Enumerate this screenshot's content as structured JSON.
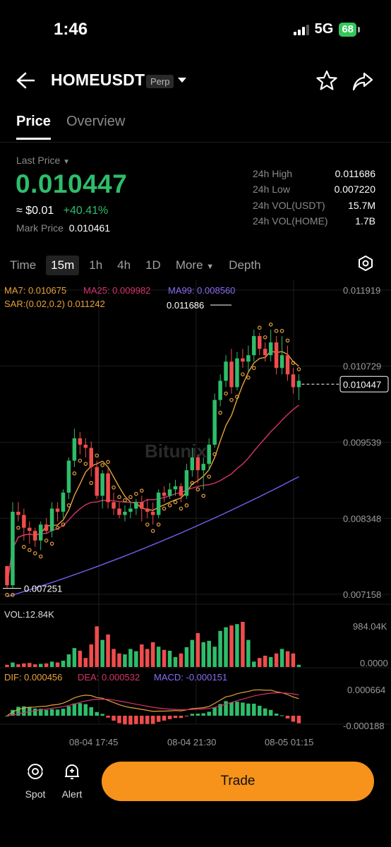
{
  "status": {
    "time": "1:46",
    "network": "5G",
    "battery": "68"
  },
  "header": {
    "symbol": "HOMEUSDT",
    "badge": "Perp"
  },
  "tabs": [
    "Price",
    "Overview"
  ],
  "ticker": {
    "last_label": "Last Price",
    "last_price": "0.010447",
    "approx": "≈ $0.01",
    "change": "+40.41%",
    "mark_label": "Mark Price",
    "mark_value": "0.010461",
    "stats": [
      {
        "label": "24h High",
        "value": "0.011686"
      },
      {
        "label": "24h Low",
        "value": "0.007220"
      },
      {
        "label": "24h VOL(USDT)",
        "value": "15.7M"
      },
      {
        "label": "24h VOL(HOME)",
        "value": "1.7B"
      }
    ]
  },
  "timeframes": {
    "time": "Time",
    "items": [
      "15m",
      "1h",
      "4h",
      "1D"
    ],
    "active": "15m",
    "more": "More",
    "depth": "Depth"
  },
  "indicators": {
    "ma7": "MA7: 0.010675",
    "ma25": "MA25: 0.009982",
    "ma99": "MA99: 0.008560",
    "sar": "SAR:(0.02,0.2)  0.011242",
    "vol": "VOL:12.84K",
    "dif": "DIF: 0.000456",
    "dea": "DEA: 0.000532",
    "macd": "MACD: -0.000151"
  },
  "chart_data": {
    "type": "candlestick",
    "price_axis": [
      "0.011919",
      "0.010729",
      "0.009539",
      "0.008348",
      "0.007158"
    ],
    "price_range": [
      0.007158,
      0.011919
    ],
    "high_label": "0.011686",
    "low_label": "0.007251",
    "current_label": "0.010447",
    "vol_axis": [
      "984.04K",
      "0.0000"
    ],
    "macd_axis": [
      "0.000664",
      "-0.000188"
    ],
    "time_labels": [
      "08-04 17:45",
      "08-04 21:30",
      "08-05 01:15"
    ],
    "watermark": "Bitunix",
    "colors": {
      "up": "#2ebd6b",
      "down": "#f04c4c",
      "ma7": "#e8a23a",
      "ma25": "#d6336c",
      "ma99": "#7c5cf0"
    },
    "candles": [
      [
        0.0076,
        0.0076,
        0.00725,
        0.0073
      ],
      [
        0.0073,
        0.0086,
        0.00725,
        0.00845
      ],
      [
        0.00845,
        0.0086,
        0.0083,
        0.0084
      ],
      [
        0.0084,
        0.0085,
        0.008,
        0.0082
      ],
      [
        0.0082,
        0.0083,
        0.00795,
        0.00815
      ],
      [
        0.00815,
        0.0082,
        0.0079,
        0.008
      ],
      [
        0.008,
        0.0083,
        0.00785,
        0.00825
      ],
      [
        0.00825,
        0.00835,
        0.0081,
        0.00815
      ],
      [
        0.00815,
        0.0086,
        0.00805,
        0.0085
      ],
      [
        0.0085,
        0.0086,
        0.0083,
        0.00845
      ],
      [
        0.00845,
        0.0088,
        0.00835,
        0.00875
      ],
      [
        0.00875,
        0.0093,
        0.00865,
        0.00925
      ],
      [
        0.00925,
        0.00975,
        0.00915,
        0.0096
      ],
      [
        0.0096,
        0.0097,
        0.00935,
        0.0095
      ],
      [
        0.0095,
        0.0096,
        0.0093,
        0.00945
      ],
      [
        0.00945,
        0.00955,
        0.009,
        0.00915
      ],
      [
        0.00915,
        0.00925,
        0.00865,
        0.0087
      ],
      [
        0.0087,
        0.0091,
        0.0085,
        0.00905
      ],
      [
        0.00905,
        0.00915,
        0.0085,
        0.0086
      ],
      [
        0.0086,
        0.00875,
        0.0084,
        0.0085
      ],
      [
        0.0085,
        0.0086,
        0.00835,
        0.0084
      ],
      [
        0.0084,
        0.00855,
        0.0083,
        0.00845
      ],
      [
        0.00845,
        0.0086,
        0.00835,
        0.0085
      ],
      [
        0.0085,
        0.00865,
        0.0084,
        0.0086
      ],
      [
        0.0086,
        0.0087,
        0.0083,
        0.0085
      ],
      [
        0.0085,
        0.00865,
        0.00835,
        0.00845
      ],
      [
        0.00845,
        0.0086,
        0.00825,
        0.0084
      ],
      [
        0.0084,
        0.0088,
        0.00835,
        0.00875
      ],
      [
        0.00875,
        0.00885,
        0.0086,
        0.0087
      ],
      [
        0.0087,
        0.0089,
        0.00865,
        0.0088
      ],
      [
        0.0088,
        0.00895,
        0.0087,
        0.00885
      ],
      [
        0.00885,
        0.0089,
        0.0086,
        0.0087
      ],
      [
        0.0087,
        0.0092,
        0.00865,
        0.0091
      ],
      [
        0.0091,
        0.00945,
        0.009,
        0.0093
      ],
      [
        0.0093,
        0.00935,
        0.0089,
        0.0091
      ],
      [
        0.0091,
        0.0093,
        0.0088,
        0.0092
      ],
      [
        0.0092,
        0.0096,
        0.0091,
        0.0095
      ],
      [
        0.0095,
        0.0103,
        0.00945,
        0.0102
      ],
      [
        0.0102,
        0.0106,
        0.0101,
        0.0105
      ],
      [
        0.0105,
        0.0109,
        0.0104,
        0.0108
      ],
      [
        0.0108,
        0.011,
        0.0103,
        0.0104
      ],
      [
        0.0104,
        0.01095,
        0.01035,
        0.01085
      ],
      [
        0.01085,
        0.011,
        0.0107,
        0.0108
      ],
      [
        0.0108,
        0.01105,
        0.01065,
        0.0109
      ],
      [
        0.0109,
        0.0113,
        0.0108,
        0.0112
      ],
      [
        0.0112,
        0.01125,
        0.0109,
        0.011
      ],
      [
        0.011,
        0.0111,
        0.0108,
        0.0109
      ],
      [
        0.0109,
        0.0113,
        0.0108,
        0.0111
      ],
      [
        0.0111,
        0.0112,
        0.0106,
        0.0107
      ],
      [
        0.0107,
        0.0112,
        0.0106,
        0.0109
      ],
      [
        0.0109,
        0.01105,
        0.0105,
        0.0106
      ],
      [
        0.0106,
        0.0107,
        0.0103,
        0.0104
      ],
      [
        0.0104,
        0.0106,
        0.0102,
        0.0105
      ]
    ],
    "volume": [
      0.05,
      0.1,
      0.06,
      0.08,
      0.09,
      0.06,
      0.07,
      0.08,
      0.12,
      0.1,
      0.14,
      0.28,
      0.42,
      0.36,
      0.2,
      0.5,
      0.9,
      0.6,
      0.72,
      0.4,
      0.3,
      0.28,
      0.4,
      0.35,
      0.5,
      0.4,
      0.55,
      0.45,
      0.38,
      0.36,
      0.22,
      0.3,
      0.44,
      0.6,
      0.75,
      0.55,
      0.58,
      0.45,
      0.8,
      0.88,
      0.92,
      0.95,
      1.0,
      0.6,
      0.12,
      0.2,
      0.25,
      0.22,
      0.3,
      0.4,
      0.35,
      0.3,
      0.05
    ]
  },
  "bottom": {
    "spot": "Spot",
    "alert": "Alert",
    "trade": "Trade"
  }
}
